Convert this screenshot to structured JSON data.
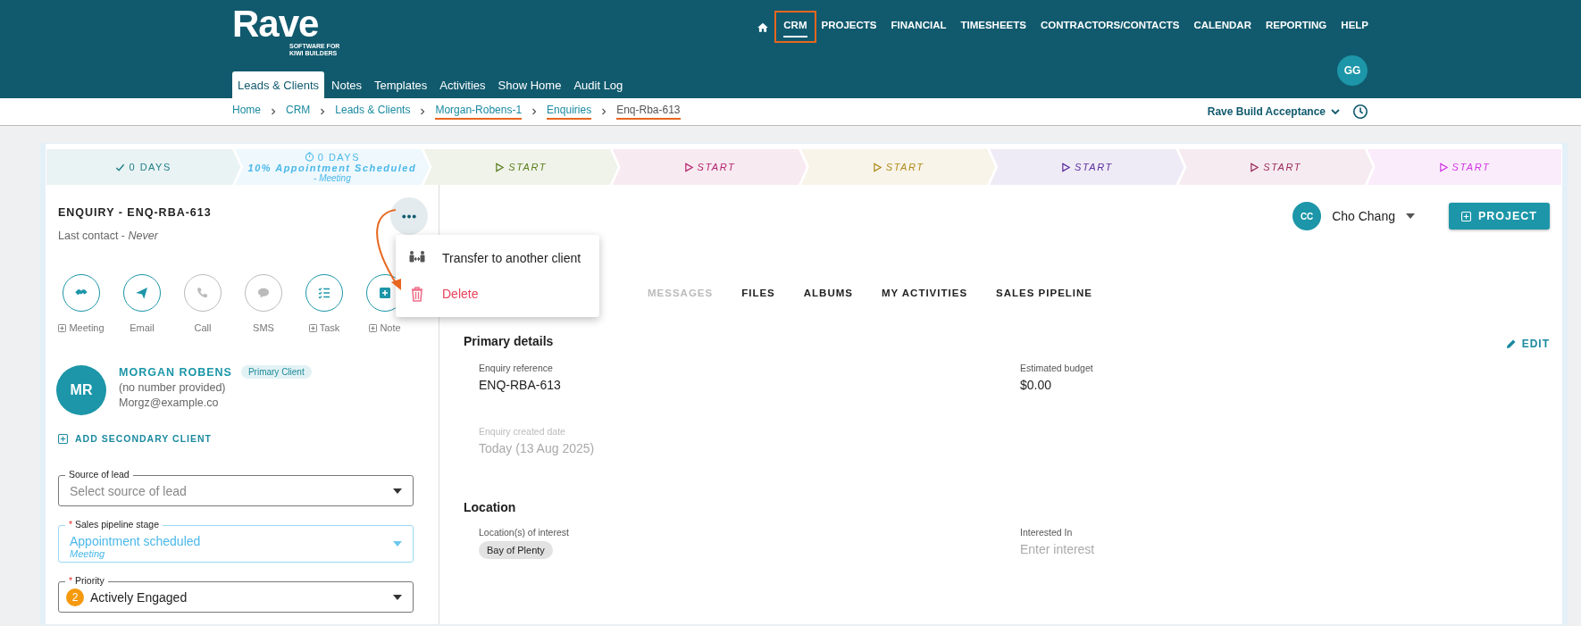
{
  "header": {
    "logo": {
      "wordmark": "Rave",
      "tagline": "SOFTWARE FOR KIWI BUILDERS"
    },
    "nav": [
      {
        "label": "CRM",
        "selected": true,
        "highlighted": true
      },
      {
        "label": "PROJECTS",
        "selected": false,
        "highlighted": false
      },
      {
        "label": "FINANCIAL",
        "selected": false,
        "highlighted": false
      },
      {
        "label": "TIMESHEETS",
        "selected": false,
        "highlighted": false
      },
      {
        "label": "CONTRACTORS/CONTACTS",
        "selected": false,
        "highlighted": false
      },
      {
        "label": "CALENDAR",
        "selected": false,
        "highlighted": false
      },
      {
        "label": "REPORTING",
        "selected": false,
        "highlighted": false
      },
      {
        "label": "HELP",
        "selected": false,
        "highlighted": false
      }
    ],
    "user_initials": "GG",
    "subnav": [
      {
        "label": "Leads & Clients",
        "selected": true
      },
      {
        "label": "Notes",
        "selected": false
      },
      {
        "label": "Templates",
        "selected": false
      },
      {
        "label": "Activities",
        "selected": false
      },
      {
        "label": "Show Home",
        "selected": false
      },
      {
        "label": "Audit Log",
        "selected": false
      }
    ]
  },
  "breadcrumbs": [
    {
      "label": "Home",
      "current": false,
      "underlined": false
    },
    {
      "label": "CRM",
      "current": false,
      "underlined": false
    },
    {
      "label": "Leads & Clients",
      "current": false,
      "underlined": false
    },
    {
      "label": "Morgan-Robens-1",
      "current": false,
      "underlined": true
    },
    {
      "label": "Enquiries",
      "current": false,
      "underlined": true
    },
    {
      "label": "Enq-Rba-613",
      "current": true,
      "underlined": true
    }
  ],
  "company": "Rave Build Acceptance",
  "pipeline": [
    {
      "kind": "done",
      "label": "0 DAYS",
      "color": "#1f7f86"
    },
    {
      "kind": "current",
      "label": "0 DAYS",
      "title": "10% Appointment Scheduled",
      "subtitle": "- Meeting",
      "color": "#4bb8ea"
    },
    {
      "kind": "pending",
      "label": "START",
      "color": "#5b7d1c"
    },
    {
      "kind": "pending",
      "label": "START",
      "color": "#b3246e"
    },
    {
      "kind": "pending",
      "label": "START",
      "color": "#b08a1a"
    },
    {
      "kind": "pending",
      "label": "START",
      "color": "#5a2d9c"
    },
    {
      "kind": "pending",
      "label": "START",
      "color": "#9c2a5c"
    },
    {
      "kind": "pending",
      "label": "START",
      "color": "#d236e4"
    }
  ],
  "enquiry": {
    "title": "ENQUIRY - ENQ-RBA-613",
    "last_contact": "Last contact - *Never*"
  },
  "actions": [
    {
      "kind": "meeting",
      "label": "Meeting",
      "addable": true,
      "disabled": false
    },
    {
      "kind": "email",
      "label": "Email",
      "addable": false,
      "disabled": false
    },
    {
      "kind": "call",
      "label": "Call",
      "addable": false,
      "disabled": true
    },
    {
      "kind": "sms",
      "label": "SMS",
      "addable": false,
      "disabled": true
    },
    {
      "kind": "task",
      "label": "Task",
      "addable": true,
      "disabled": false
    },
    {
      "kind": "note",
      "label": "Note",
      "addable": true,
      "disabled": false
    }
  ],
  "more_menu": {
    "open": true,
    "items": [
      {
        "kind": "transfer",
        "label": "Transfer to another client"
      },
      {
        "kind": "delete",
        "label": "Delete"
      }
    ]
  },
  "client": {
    "initials": "MR",
    "name": "MORGAN ROBENS",
    "badge": "Primary Client",
    "phone": "(no number provided)",
    "email": "Morgz@example.co"
  },
  "add_secondary": "ADD SECONDARY CLIENT",
  "form": [
    {
      "kind": "select",
      "label": "Source of lead",
      "placeholder": "Select source of lead"
    },
    {
      "kind": "stage",
      "label": "Sales pipeline stage",
      "required_mark": "*",
      "value": "Appointment scheduled",
      "subvalue": "Meeting"
    },
    {
      "kind": "priority",
      "label": "Priority",
      "required_mark": "*",
      "badge": "2",
      "value": "Actively Engaged"
    }
  ],
  "owner": {
    "initials": "CC",
    "name": "Cho Chang"
  },
  "project_button": "PROJECT",
  "tabs": [
    {
      "label": "MESSAGES",
      "disabled": true,
      "selected": false
    },
    {
      "label": "FILES",
      "disabled": false,
      "selected": false
    },
    {
      "label": "ALBUMS",
      "disabled": false,
      "selected": false
    },
    {
      "label": "MY ACTIVITIES",
      "disabled": false,
      "selected": false
    },
    {
      "label": "SALES PIPELINE",
      "disabled": false,
      "selected": false
    }
  ],
  "sections": [
    {
      "title": "Primary details",
      "edit": "EDIT",
      "fields": [
        {
          "kind": "text",
          "label": "Enquiry reference",
          "value": "ENQ-RBA-613",
          "disabled": false
        },
        {
          "kind": "text",
          "label": "Estimated budget",
          "value": "$0.00",
          "disabled": false
        },
        {
          "kind": "text",
          "label": "Enquiry created date",
          "value": "Today (13 Aug 2025)",
          "disabled": true
        }
      ]
    },
    {
      "title": "Location",
      "fields": [
        {
          "kind": "chips",
          "label": "Location(s) of interest",
          "chips": [
            "Bay of Plenty"
          ]
        },
        {
          "kind": "input",
          "label": "Interested In",
          "placeholder": "Enter interest"
        }
      ]
    }
  ]
}
